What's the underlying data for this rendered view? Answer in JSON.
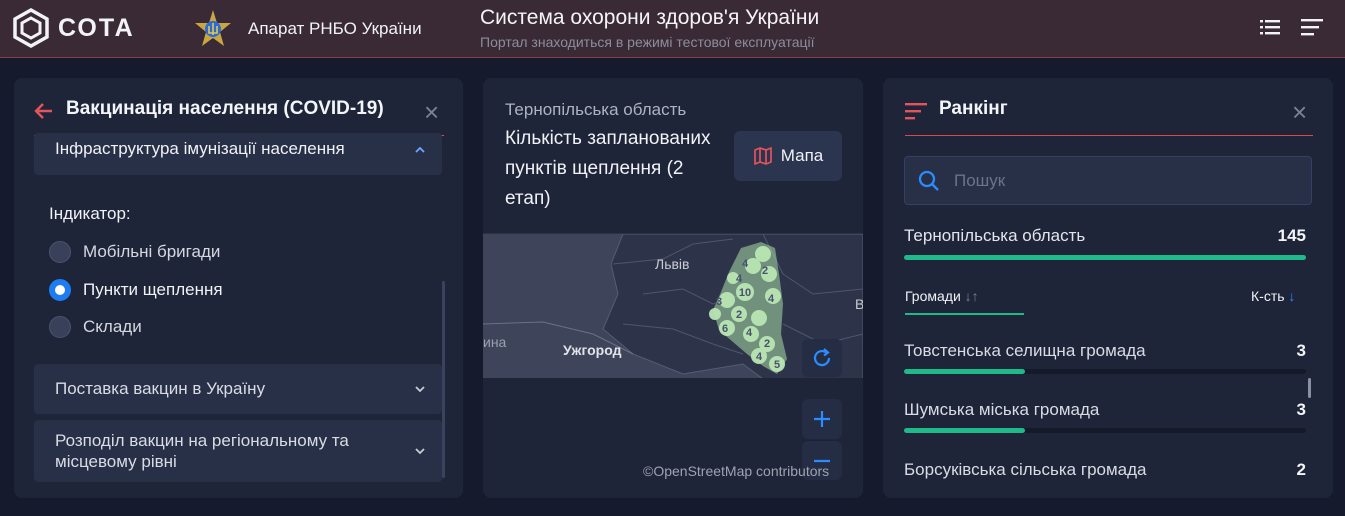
{
  "header": {
    "logo_text": "СОТА",
    "org_label": "Апарат РНБО України",
    "title": "Система охорони здоров'я України",
    "subtitle": "Портал знаходиться в режимі тестової експлуатації"
  },
  "left_panel": {
    "title": "Вакцинація населення (COVID-19)",
    "open_section": "Інфраструктура імунізації населення",
    "indicator_label": "Індикатор:",
    "options": [
      {
        "label": "Мобільні бригади",
        "selected": false
      },
      {
        "label": "Пункти щеплення",
        "selected": true
      },
      {
        "label": "Склади",
        "selected": false
      }
    ],
    "sections": [
      {
        "label": "Поставка вакцин в Україну"
      },
      {
        "label": "Розподіл вакцин на регіональному та місцевому рівні"
      }
    ]
  },
  "map_panel": {
    "region": "Тернопільська область",
    "indicator": "Кількість запланованих пунктів щеплення (2 етап)",
    "map_button": "Мапа",
    "labels": {
      "lviv": "Львів",
      "uzhhorod": "Ужгород",
      "partial_left": "ина",
      "partial_right": "В"
    },
    "clusters": [
      "4",
      "2",
      "4",
      "10",
      "3",
      "4",
      "2",
      "6",
      "4",
      "2",
      "4",
      "5"
    ],
    "attribution": "©OpenStreetMap contributors"
  },
  "ranking_panel": {
    "title": "Ранкінг",
    "search_placeholder": "Пошук",
    "region": {
      "name": "Тернопільська область",
      "value": "145"
    },
    "col_communities": "Громади",
    "col_count": "К-сть",
    "rows": [
      {
        "name": "Товстенська селищна громада",
        "value": "3",
        "fraction": 0.3
      },
      {
        "name": "Шумська міська громада",
        "value": "3",
        "fraction": 0.3
      },
      {
        "name": "Борсуківська сільська громада",
        "value": "2",
        "fraction": 0.2
      }
    ]
  },
  "colors": {
    "accent_red": "#d9474f",
    "accent_green": "#1fb98a",
    "accent_blue": "#1d7cf2"
  }
}
